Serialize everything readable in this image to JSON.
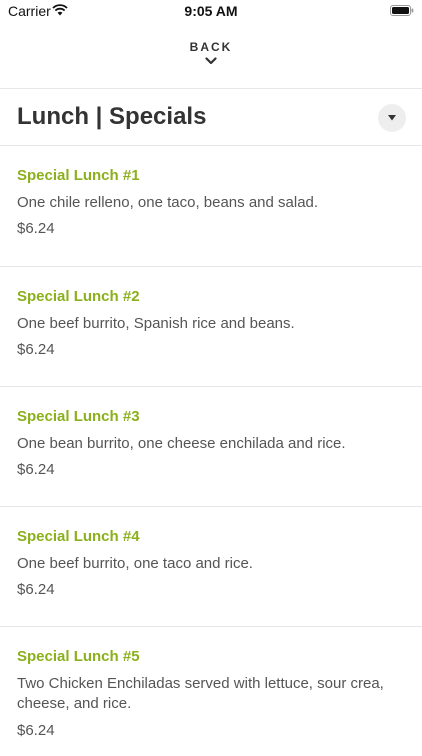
{
  "status_bar": {
    "carrier": "Carrier",
    "time": "9:05 AM"
  },
  "nav": {
    "back_label": "BACK"
  },
  "header": {
    "title": "Lunch | Specials"
  },
  "colors": {
    "accent": "#8cb01c",
    "text": "#333333",
    "muted": "#555555",
    "divider": "#e7e7e7"
  },
  "items": [
    {
      "name": "Special Lunch #1",
      "description": "One chile relleno, one taco, beans and salad.",
      "price": "$6.24"
    },
    {
      "name": "Special Lunch #2",
      "description": "One beef burrito, Spanish rice and beans.",
      "price": "$6.24"
    },
    {
      "name": "Special Lunch #3",
      "description": "One bean burrito, one cheese enchilada and rice.",
      "price": "$6.24"
    },
    {
      "name": "Special Lunch #4",
      "description": "One beef burrito, one taco and rice.",
      "price": "$6.24"
    },
    {
      "name": "Special Lunch #5",
      "description": "Two Chicken Enchiladas served with lettuce, sour crea, cheese, and rice.",
      "price": "$6.24"
    }
  ]
}
